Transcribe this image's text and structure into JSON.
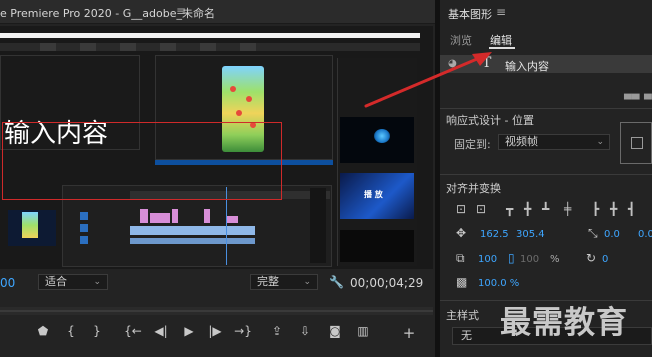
{
  "app": {
    "title": "e Premiere Pro 2020 - G__adobe_未命名",
    "menu_icon": "≡"
  },
  "canvas": {
    "overlay_text": "输入内容"
  },
  "program_monitor": {
    "timecode_current": "00",
    "fit_select": "适合",
    "quality_select": "完整",
    "timecode_duration": "00;00;04;29"
  },
  "transport": {
    "buttons": [
      "marker-in",
      "mark-in",
      "mark-out",
      "go-to-in",
      "step-back",
      "play",
      "step-forward",
      "go-to-out",
      "lift",
      "extract",
      "export-frame",
      "compare",
      "add"
    ]
  },
  "essential_graphics": {
    "panel_title": "基本图形",
    "menu_icon": "≡",
    "tabs": [
      {
        "label": "浏览",
        "active": false
      },
      {
        "label": "编辑",
        "active": true
      }
    ],
    "layer": {
      "type_icon": "T",
      "label": "输入内容"
    },
    "responsive_design": {
      "title": "响应式设计 - 位置",
      "pin_to_label": "固定到:",
      "pin_to_value": "视频帧"
    },
    "align_transform": {
      "title": "对齐并变换",
      "position_x": "162.5",
      "position_y": "305.4",
      "anchor_x": "0.0",
      "anchor_y": "0.0",
      "scale": "100",
      "scale_locked": "100",
      "scale_unit": "%",
      "rotation": "0",
      "opacity": "100.0 %"
    },
    "master_style": {
      "title": "主样式",
      "value": "无"
    }
  },
  "watermark": "最需教育",
  "colors": {
    "accent_blue": "#3ea6ff",
    "annotation_red": "#cf2a2a",
    "clip_pink": "#d78ed7",
    "clip_blue": "#8fb8e8"
  }
}
